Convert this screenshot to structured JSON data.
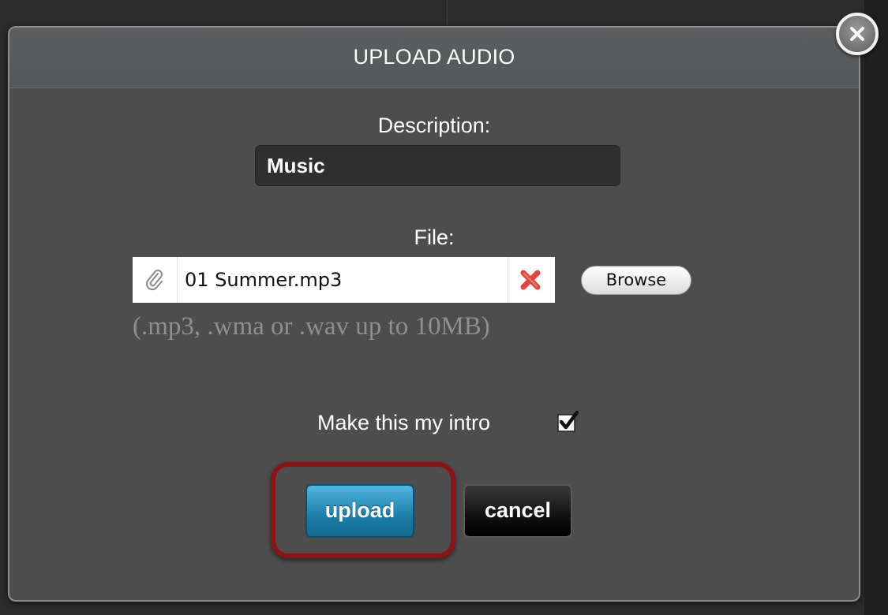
{
  "dialog": {
    "title": "UPLOAD AUDIO",
    "close_icon": "close-icon"
  },
  "description": {
    "label": "Description:",
    "value": "Music"
  },
  "file": {
    "label": "File:",
    "attachment_icon": "paperclip-icon",
    "name": "01 Summer.mp3",
    "remove_icon": "remove-x-icon",
    "browse_label": "Browse",
    "hint": "(.mp3, .wma or .wav up to 10MB)"
  },
  "intro": {
    "label": "Make this my intro",
    "checked": true
  },
  "actions": {
    "upload_label": "upload",
    "cancel_label": "cancel"
  },
  "colors": {
    "dialog_bg": "#4d4d4d",
    "upload_accent": "#1d7ea8",
    "highlight_ring": "#8c1417",
    "remove_x": "#e0463c"
  }
}
